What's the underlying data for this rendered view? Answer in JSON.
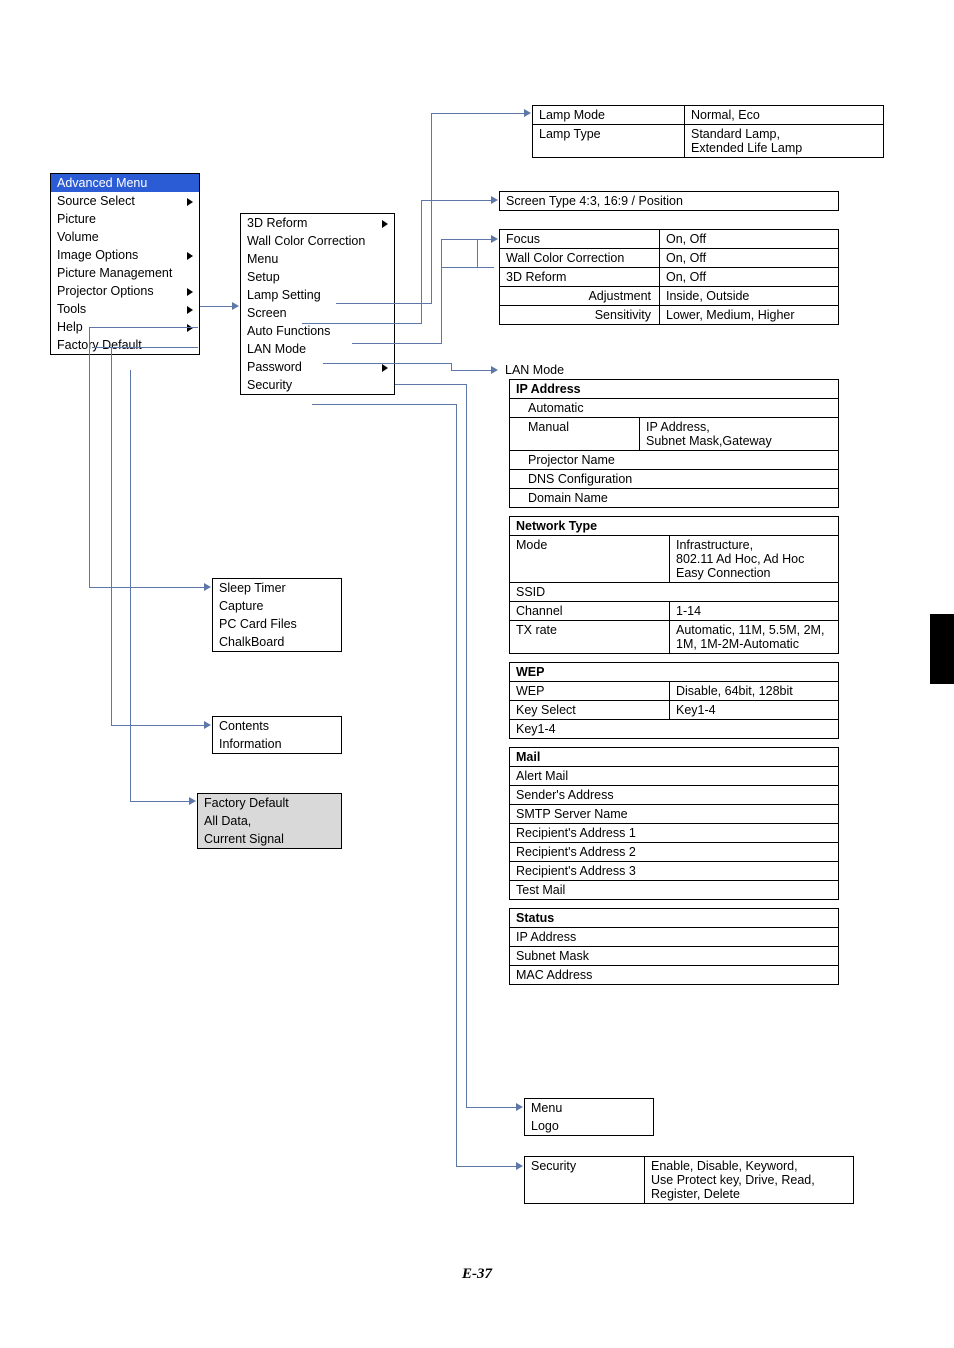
{
  "footer": "E-37",
  "advanced_menu": {
    "header": "Advanced Menu",
    "items": [
      {
        "label": "Source Select",
        "sub": true
      },
      {
        "label": "Picture",
        "sub": false
      },
      {
        "label": "Volume",
        "sub": false
      },
      {
        "label": "Image Options",
        "sub": true
      },
      {
        "label": "Picture Management",
        "sub": false
      },
      {
        "label": "Projector Options",
        "sub": true
      },
      {
        "label": "Tools",
        "sub": true
      },
      {
        "label": "Help",
        "sub": true
      },
      {
        "label": "Factory Default",
        "sub": false
      }
    ]
  },
  "projector_options": {
    "items": [
      {
        "label": "3D Reform",
        "sub": true
      },
      {
        "label": "Wall Color Correction"
      },
      {
        "label": "Menu"
      },
      {
        "label": "Setup"
      },
      {
        "label": "Lamp Setting"
      },
      {
        "label": "Screen"
      },
      {
        "label": "Auto Functions"
      },
      {
        "label": "LAN Mode"
      },
      {
        "label": "Password",
        "sub": true
      },
      {
        "label": "Security"
      }
    ]
  },
  "tools": {
    "items": [
      "Sleep Timer",
      "Capture",
      "PC Card Files",
      "ChalkBoard"
    ]
  },
  "help": {
    "items": [
      "Contents",
      "Information"
    ]
  },
  "factory_default": {
    "items": [
      "Factory Default",
      "All Data,",
      "Current Signal"
    ]
  },
  "lamp": {
    "mode_k": "Lamp Mode",
    "mode_v": "Normal, Eco",
    "type_k": "Lamp Type",
    "type_v": "Standard Lamp,\nExtended Life Lamp"
  },
  "screen": {
    "text": "Screen Type 4:3, 16:9 / Position"
  },
  "autofn": {
    "focus_k": "Focus",
    "focus_v": "On, Off",
    "wcc_k": "Wall Color Correction",
    "wcc_v": "On, Off",
    "r3d_k": "3D Reform",
    "r3d_v": "On, Off",
    "adj_k": "Adjustment",
    "adj_v": "Inside, Outside",
    "sen_k": "Sensitivity",
    "sen_v": "Lower, Medium, Higher"
  },
  "lanmode": {
    "title": "LAN Mode",
    "ip": {
      "hdr": "IP Address",
      "auto": "Automatic",
      "manual_k": "Manual",
      "manual_v": "IP Address,\nSubnet Mask,Gateway",
      "pname": "Projector Name",
      "dns": "DNS Configuration",
      "domain": "Domain Name"
    },
    "net": {
      "hdr": "Network Type",
      "mode_k": "Mode",
      "mode_v": "Infrastructure,\n802.11 Ad Hoc, Ad Hoc\nEasy Connection",
      "ssid": "SSID",
      "ch_k": "Channel",
      "ch_v": "1-14",
      "tx_k": "TX rate",
      "tx_v": "Automatic, 11M, 5.5M, 2M,\n1M, 1M-2M-Automatic"
    },
    "wep": {
      "hdr": "WEP",
      "wep_k": "WEP",
      "wep_v": "Disable, 64bit, 128bit",
      "ks_k": "Key Select",
      "ks_v": "Key1-4",
      "k14": "Key1-4"
    },
    "mail": {
      "hdr": "Mail",
      "alert": "Alert Mail",
      "sender": "Sender's Address",
      "smtp": "SMTP Server Name",
      "r1": "Recipient's Address 1",
      "r2": "Recipient's Address 2",
      "r3": "Recipient's Address 3",
      "test": "Test Mail"
    },
    "status": {
      "hdr": "Status",
      "ip": "IP Address",
      "sn": "Subnet Mask",
      "mac": "MAC Address"
    }
  },
  "password": {
    "menu": "Menu",
    "logo": "Logo"
  },
  "security": {
    "k": "Security",
    "v": "Enable, Disable, Keyword,\nUse Protect key, Drive, Read,\nRegister, Delete"
  }
}
